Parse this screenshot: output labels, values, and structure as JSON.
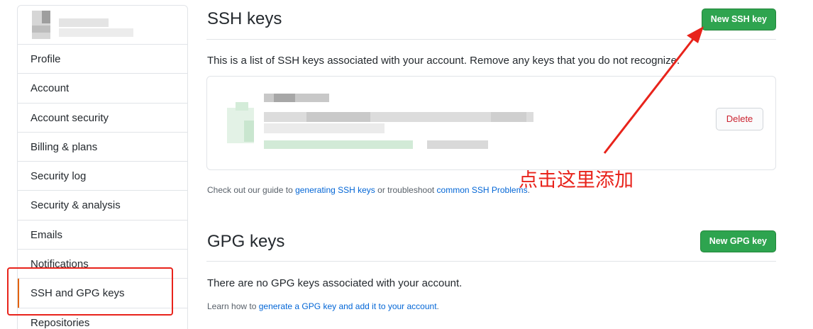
{
  "sidebar": {
    "items": [
      {
        "label": "Profile"
      },
      {
        "label": "Account"
      },
      {
        "label": "Account security"
      },
      {
        "label": "Billing & plans"
      },
      {
        "label": "Security log"
      },
      {
        "label": "Security & analysis"
      },
      {
        "label": "Emails"
      },
      {
        "label": "Notifications"
      },
      {
        "label": "SSH and GPG keys",
        "selected": true
      },
      {
        "label": "Repositories"
      }
    ]
  },
  "ssh": {
    "title": "SSH keys",
    "new_button": "New SSH key",
    "description": "This is a list of SSH keys associated with your account. Remove any keys that you do not recognize.",
    "delete_button": "Delete",
    "guide_prefix": "Check out our guide to ",
    "guide_link": "generating SSH keys",
    "guide_middle": " or troubleshoot ",
    "guide_link2": "common SSH Problems",
    "guide_suffix": "."
  },
  "gpg": {
    "title": "GPG keys",
    "new_button": "New GPG key",
    "description": "There are no GPG keys associated with your account.",
    "learn_prefix": "Learn how to ",
    "learn_link": "generate a GPG key and add it to your account",
    "learn_suffix": "."
  },
  "annotation": {
    "text": "点击这里添加",
    "color": "#e8231b"
  },
  "colors": {
    "accent_green": "#2ea44f",
    "link": "#0366d6",
    "danger": "#cb2431",
    "selected_marker": "#e36209"
  }
}
